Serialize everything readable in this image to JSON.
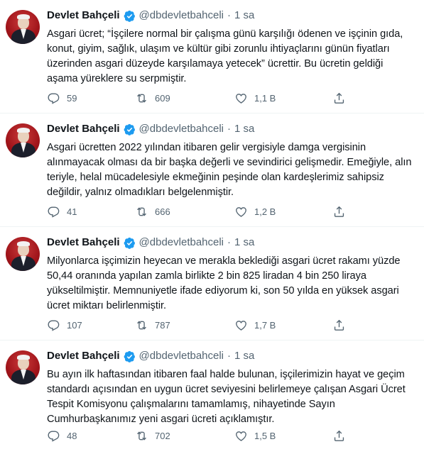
{
  "tweets": [
    {
      "name": "Devlet Bahçeli",
      "handle": "@dbdevletbahceli",
      "sep": "·",
      "time": "1 sa",
      "text": "Asgari ücret; “İşçilere normal bir çalışma günü karşılığı ödenen ve işçinin gıda, konut, giyim, sağlık, ulaşım ve kültür gibi zorunlu ihtiyaçlarını günün fiyatları üzerinden asgari düzeyde karşılamaya yetecek” ücrettir. Bu ücretin geldiği aşama yüreklere su serpmiştir.",
      "replies": "59",
      "retweets": "609",
      "likes": "1,1 B"
    },
    {
      "name": "Devlet Bahçeli",
      "handle": "@dbdevletbahceli",
      "sep": "·",
      "time": "1 sa",
      "text": "Asgari ücretten 2022 yılından itibaren gelir vergisiyle damga vergisinin alınmayacak olması da bir başka değerli ve sevindirici gelişmedir. Emeğiyle, alın teriyle, helal mücadelesiyle ekmeğinin peşinde olan kardeşlerimiz sahipsiz değildir, yalnız olmadıkları belgelenmiştir.",
      "replies": "41",
      "retweets": "666",
      "likes": "1,2 B"
    },
    {
      "name": "Devlet Bahçeli",
      "handle": "@dbdevletbahceli",
      "sep": "·",
      "time": "1 sa",
      "text": "Milyonlarca işçimizin heyecan ve merakla beklediği asgari ücret rakamı yüzde 50,44 oranında yapılan zamla birlikte 2 bin 825 liradan 4 bin 250 liraya yükseltilmiştir. Memnuniyetle ifade ediyorum ki, son 50 yılda en yüksek asgari ücret miktarı belirlenmiştir.",
      "replies": "107",
      "retweets": "787",
      "likes": "1,7 B"
    },
    {
      "name": "Devlet Bahçeli",
      "handle": "@dbdevletbahceli",
      "sep": "·",
      "time": "1 sa",
      "text": "Bu ayın ilk haftasından itibaren faal halde bulunan, işçilerimizin hayat ve geçim standardı açısından en uygun ücret seviyesini belirlemeye çalışan Asgari Ücret Tespit Komisyonu çalışmalarını tamamlamış, nihayetinde Sayın Cumhurbaşkanımız yeni asgari ücreti açıklamıştır.",
      "replies": "48",
      "retweets": "702",
      "likes": "1,5 B"
    }
  ],
  "colors": {
    "verified": "#1d9bf0",
    "meta": "#536471",
    "text": "#0f1419",
    "divider": "#eff3f4"
  },
  "icons": [
    "reply-icon",
    "retweet-icon",
    "like-icon",
    "share-icon",
    "verified-badge-icon"
  ]
}
